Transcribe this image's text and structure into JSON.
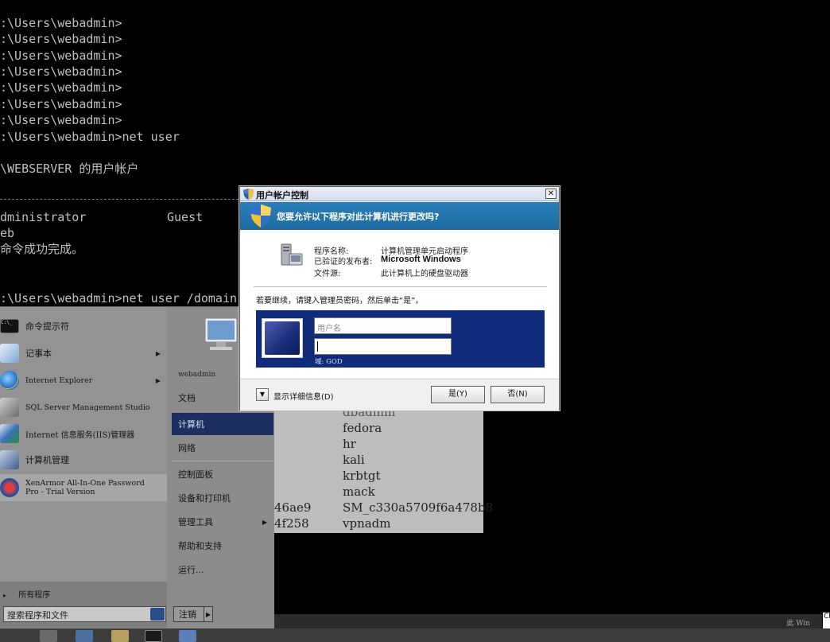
{
  "console": {
    "lines": [
      ":\\Users\\webadmin>",
      ":\\Users\\webadmin>",
      ":\\Users\\webadmin>",
      ":\\Users\\webadmin>",
      ":\\Users\\webadmin>",
      ":\\Users\\webadmin>",
      ":\\Users\\webadmin>",
      ":\\Users\\webadmin>net user"
    ],
    "accounts_header": "\\WEBSERVER 的用户帐户",
    "accounts_row1_col1": "dministrator",
    "accounts_row1_col2": "Guest",
    "accounts_row2": "eb",
    "success": "命令成功完成。",
    "domain_cmd": ":\\Users\\webadmin>net user /domain",
    "domain_users": [
      "dbadmin",
      "fedora",
      "hr",
      "kali",
      "krbtgt",
      "mack",
      "SM_c330a5709f6a478b8",
      "vpnadm"
    ],
    "domain_users_left": [
      "46ae9",
      "4f258"
    ]
  },
  "start_menu": {
    "left_items": [
      {
        "label": "命令提示符",
        "icon": "cmd-icon",
        "arrow": false
      },
      {
        "label": "记事本",
        "icon": "notepad-icon",
        "arrow": true
      },
      {
        "label": "Internet Explorer",
        "icon": "ie-icon",
        "arrow": true
      },
      {
        "label": "SQL Server Management Studio",
        "icon": "sql-icon",
        "arrow": false
      },
      {
        "label": "Internet 信息服务(IIS)管理器",
        "icon": "iis-icon",
        "arrow": false
      },
      {
        "label": "计算机管理",
        "icon": "computer-management-icon",
        "arrow": false
      },
      {
        "label": "XenArmor All-In-One Password\nPro - Trial Version",
        "icon": "xenarmor-icon",
        "arrow": false
      }
    ],
    "all_programs": "所有程序",
    "search_placeholder": "搜索程序和文件",
    "user_name": "webadmin",
    "right_items": [
      {
        "label": "文档",
        "arrow": false,
        "selected": false
      },
      {
        "label": "计算机",
        "arrow": false,
        "selected": true
      },
      {
        "label": "网络",
        "arrow": false,
        "selected": false
      },
      {
        "label": "控制面板",
        "arrow": false,
        "selected": false
      },
      {
        "label": "设备和打印机",
        "arrow": false,
        "selected": false
      },
      {
        "label": "管理工具",
        "arrow": true,
        "selected": false
      },
      {
        "label": "帮助和支持",
        "arrow": false,
        "selected": false
      },
      {
        "label": "运行...",
        "arrow": false,
        "selected": false
      }
    ],
    "logoff_label": "注销"
  },
  "uac": {
    "title": "用户帐户控制",
    "question": "您要允许以下程序对此计算机进行更改吗?",
    "program_name_label": "程序名称:",
    "program_name_value": "计算机管理单元启动程序",
    "publisher_label": "已验证的发布者:",
    "publisher_value": "Microsoft Windows",
    "source_label": "文件源:",
    "source_value": "此计算机上的硬盘驱动器",
    "instruction": "若要继续，请键入管理员密码，然后单击“是”。",
    "username_placeholder": "用户名",
    "password_value": "",
    "domain": "域: GOD",
    "details_label": "显示详细信息(D)",
    "yes_label": "是(Y)",
    "no_label": "否(N)"
  },
  "hostbar": {
    "text": "此 Win",
    "box": "Cl"
  }
}
